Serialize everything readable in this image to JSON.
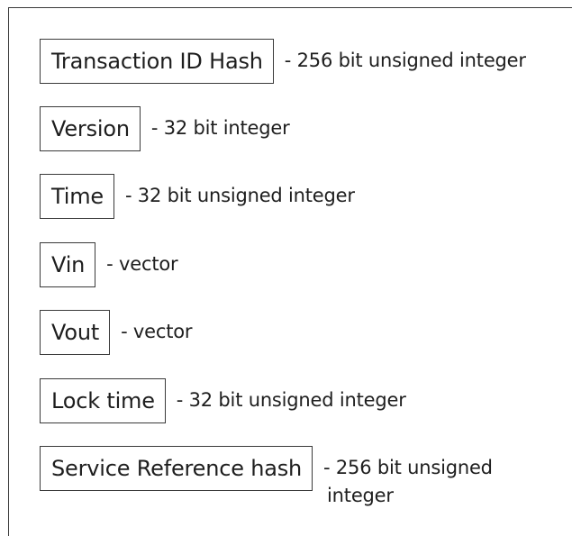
{
  "fields": [
    {
      "name": "Transaction ID Hash",
      "description": "- 256 bit unsigned integer"
    },
    {
      "name": "Version",
      "description": "- 32 bit integer"
    },
    {
      "name": "Time",
      "description": "- 32 bit unsigned integer"
    },
    {
      "name": "Vin",
      "description": "- vector"
    },
    {
      "name": "Vout",
      "description": "- vector"
    },
    {
      "name": "Lock time",
      "description": "- 32 bit unsigned integer"
    },
    {
      "name": "Service Reference hash",
      "description_line1": "- 256 bit unsigned",
      "description_line2": "integer"
    }
  ]
}
